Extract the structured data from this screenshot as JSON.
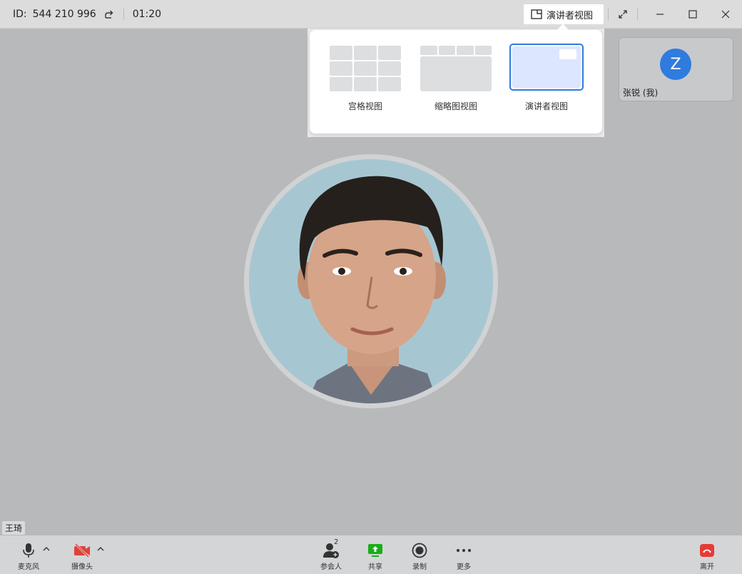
{
  "titlebar": {
    "id_label": "ID:",
    "meeting_id": "544 210 996",
    "timer": "01:20",
    "view_button_label": "演讲者视图"
  },
  "view_menu": {
    "options": [
      {
        "label": "宫格视图",
        "icon": "grid-view-icon"
      },
      {
        "label": "缩略图视图",
        "icon": "thumbnail-view-icon"
      },
      {
        "label": "演讲者视图",
        "icon": "presenter-view-icon",
        "selected": true
      }
    ]
  },
  "self_tile": {
    "avatar_letter": "Z",
    "name": "张锐 (我)",
    "avatar_color": "#2f7bde"
  },
  "main_speaker": {
    "name": "王琦"
  },
  "toolbar": {
    "mic_label": "麦克风",
    "camera_label": "摄像头",
    "participants_label": "参会人",
    "participants_count": "2",
    "share_label": "共享",
    "record_label": "录制",
    "more_label": "更多",
    "leave_label": "离开"
  },
  "colors": {
    "accent": "#2f7bde",
    "share_green": "#1aad19",
    "leave_red": "#e63b36",
    "camera_off_red": "#e0413a"
  }
}
